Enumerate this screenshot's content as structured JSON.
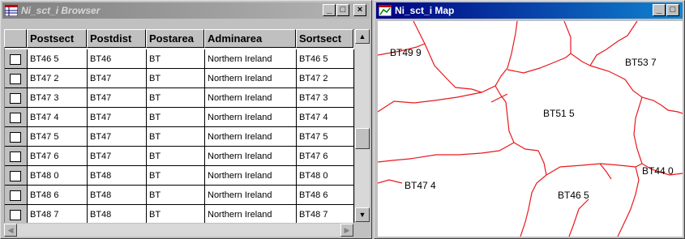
{
  "browser": {
    "title": "Ni_sct_i Browser",
    "columns": [
      "Postsect",
      "Postdist",
      "Postarea",
      "Adminarea",
      "Sortsect"
    ],
    "rows": [
      [
        "BT46 5",
        "BT46",
        "BT",
        "Northern Ireland",
        "BT46 5"
      ],
      [
        "BT47 2",
        "BT47",
        "BT",
        "Northern Ireland",
        "BT47 2"
      ],
      [
        "BT47 3",
        "BT47",
        "BT",
        "Northern Ireland",
        "BT47 3"
      ],
      [
        "BT47 4",
        "BT47",
        "BT",
        "Northern Ireland",
        "BT47 4"
      ],
      [
        "BT47 5",
        "BT47",
        "BT",
        "Northern Ireland",
        "BT47 5"
      ],
      [
        "BT47 6",
        "BT47",
        "BT",
        "Northern Ireland",
        "BT47 6"
      ],
      [
        "BT48 0",
        "BT48",
        "BT",
        "Northern Ireland",
        "BT48 0"
      ],
      [
        "BT48 6",
        "BT48",
        "BT",
        "Northern Ireland",
        "BT48 6"
      ],
      [
        "BT48 7",
        "BT48",
        "BT",
        "Northern Ireland",
        "BT48 7"
      ]
    ],
    "controls": {
      "minimize": "_",
      "maximize": "□",
      "close": "×",
      "scroll_up": "▲",
      "scroll_down": "▼",
      "scroll_left": "◀",
      "scroll_right": "▶"
    }
  },
  "map": {
    "title": "Ni_sct_i Map",
    "controls": {
      "minimize": "_",
      "maximize": "□"
    },
    "labels": {
      "bt49_9": "BT49 9",
      "bt53_7": "BT53 7",
      "bt51_5": "BT51 5",
      "bt44_0": "BT44 0",
      "bt47_4": "BT47 4",
      "bt46_5": "BT46 5"
    },
    "boundary_color": "#e8191e"
  },
  "colors": {
    "titlebar_active": "#000080",
    "titlebar_inactive": "#808080"
  }
}
